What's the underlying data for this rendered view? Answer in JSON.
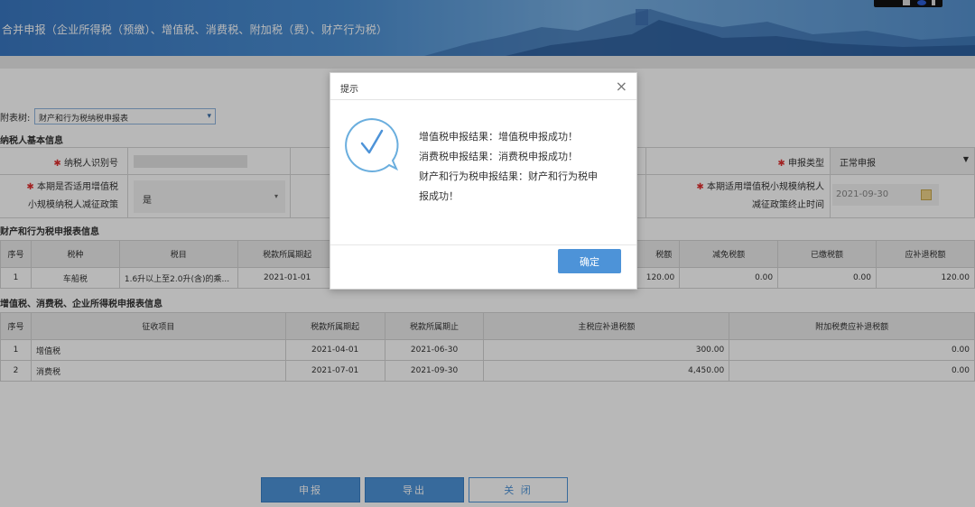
{
  "header": {
    "title": "合并申报（企业所得税（预缴）、增值税、消费税、附加税（费）、财产行为税）"
  },
  "attach": {
    "label": "附表树:",
    "selected": "财产和行为税纳税申报表"
  },
  "basic_info": {
    "section_title": "纳税人基本信息",
    "taxpayer_id_label": "纳税人识别号",
    "declare_type_label": "申报类型",
    "declare_type_value": "正常申报",
    "small_scale_label_line1": "本期是否适用增值税",
    "small_scale_label_line2": "小规模纳税人减征政策",
    "small_scale_value": "是",
    "end_time_label_line1": "本期适用增值税小规模纳税人",
    "end_time_label_line2": "减征政策终止时间",
    "end_time_value": "2021-09-30"
  },
  "property_table": {
    "section_title": "财产和行为税申报表信息",
    "headers": [
      "序号",
      "税种",
      "税目",
      "税款所属期起",
      "税额",
      "减免税额",
      "已缴税额",
      "应补退税额"
    ],
    "rows": [
      [
        "1",
        "车船税",
        "1.6升以上至2.0升(含)的乘...",
        "2021-01-01",
        "120.00",
        "0.00",
        "0.00",
        "120.00"
      ]
    ]
  },
  "vat_table": {
    "section_title": "增值税、消费税、企业所得税申报表信息",
    "headers": [
      "序号",
      "征收项目",
      "税款所属期起",
      "税款所属期止",
      "主税应补退税额",
      "附加税费应补退税额"
    ],
    "rows": [
      [
        "1",
        "增值税",
        "2021-04-01",
        "2021-06-30",
        "300.00",
        "0.00"
      ],
      [
        "2",
        "消费税",
        "2021-07-01",
        "2021-09-30",
        "4,450.00",
        "0.00"
      ]
    ]
  },
  "footer": {
    "submit": "申报",
    "export": "导出",
    "close": "关 闭"
  },
  "dialog": {
    "title": "提示",
    "close": "×",
    "messages": [
      "增值税申报结果：增值税申报成功！",
      "消费税申报结果：消费税申报成功！",
      "财产和行为税申报结果：财产和行为税申",
      "报成功！"
    ],
    "ok": "确定"
  },
  "colors": {
    "primary": "#4d93d8",
    "required": "#e03030"
  }
}
